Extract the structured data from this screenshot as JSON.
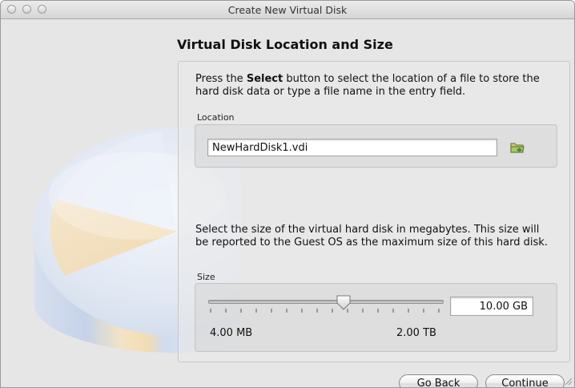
{
  "window": {
    "title": "Create New Virtual Disk"
  },
  "page": {
    "heading": "Virtual Disk Location and Size"
  },
  "location": {
    "text_before": "Press the ",
    "text_bold": "Select",
    "text_after": " button to select the location of a file to store the hard disk data or type a file name in the entry field.",
    "group_label": "Location",
    "value": "NewHardDisk1.vdi",
    "select_button_icon": "folder-select-icon"
  },
  "size": {
    "description": "Select the size of the virtual hard disk in megabytes. This size will be reported to the Guest OS as the maximum size of this hard disk.",
    "group_label": "Size",
    "value": "10.00 GB",
    "min_label": "4.00 MB",
    "max_label": "2.00 TB",
    "slider_fraction": 0.62
  },
  "buttons": {
    "back": "Go Back",
    "continue": "Continue"
  },
  "colors": {
    "window_bg": "#e6e6e6",
    "disk_top_highlight": "#f3e0bd",
    "disk_side": "#c8d6ec"
  }
}
